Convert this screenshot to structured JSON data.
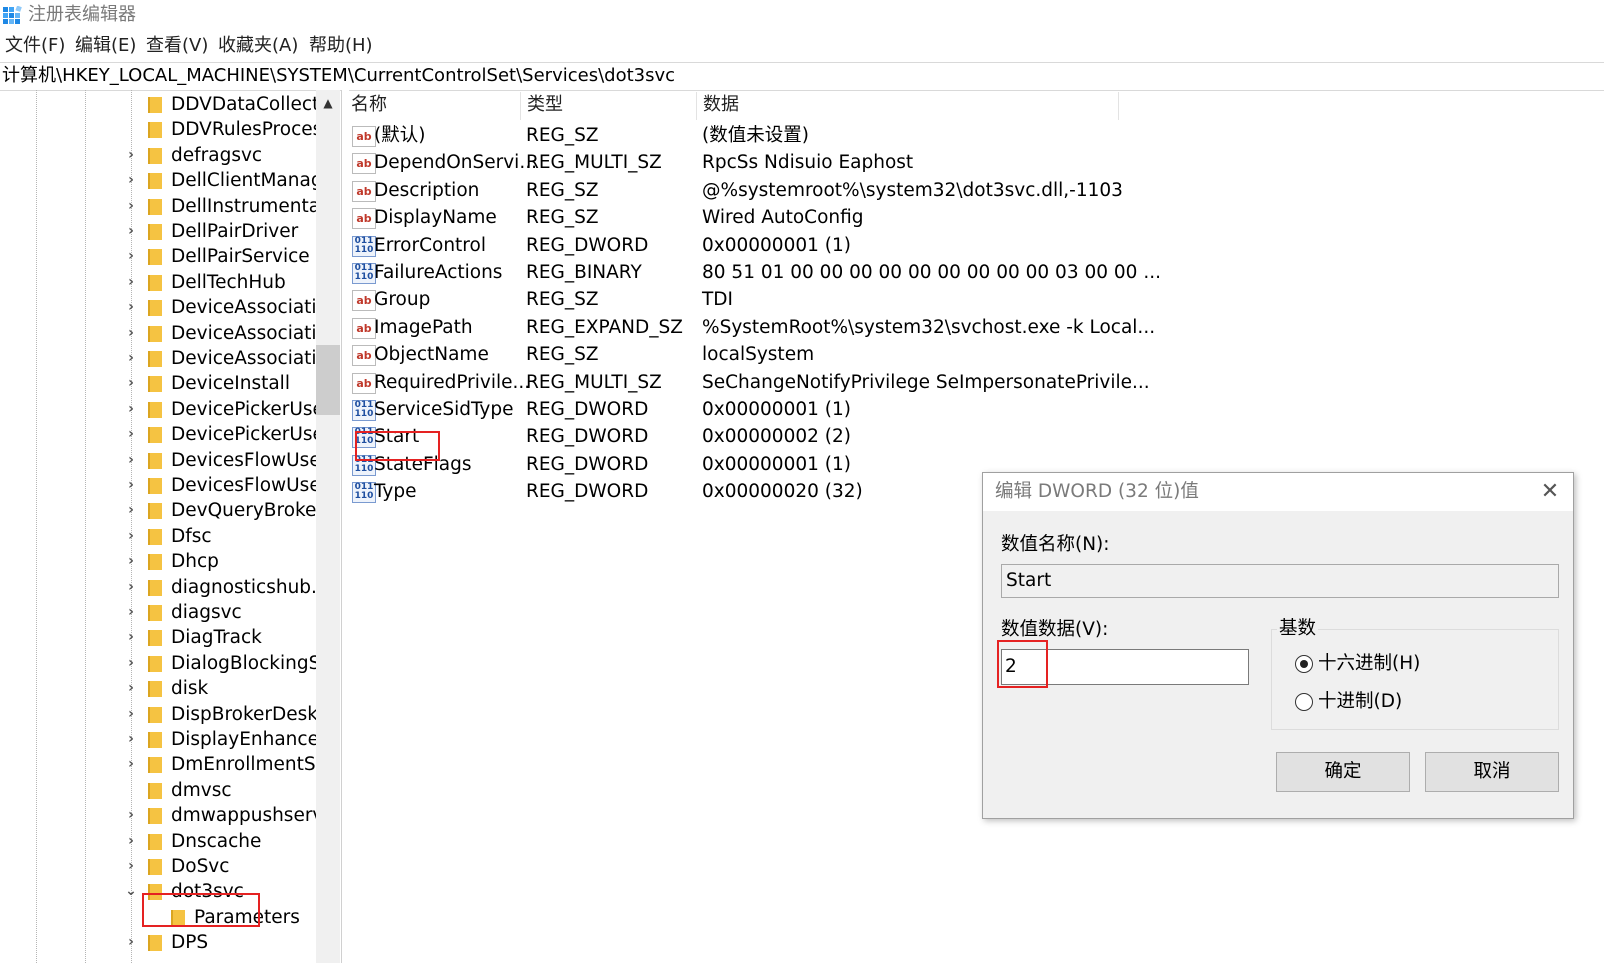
{
  "window": {
    "title": "注册表编辑器"
  },
  "menu": [
    "文件(F)",
    "编辑(E)",
    "查看(V)",
    "收藏夹(A)",
    "帮助(H)"
  ],
  "address": "计算机\\HKEY_LOCAL_MACHINE\\SYSTEM\\CurrentControlSet\\Services\\dot3svc",
  "tree": [
    {
      "label": "DDVDataCollect",
      "arrow": ""
    },
    {
      "label": "DDVRulesProces",
      "arrow": ""
    },
    {
      "label": "defragsvc",
      "arrow": ">"
    },
    {
      "label": "DellClientManag",
      "arrow": ">"
    },
    {
      "label": "DellInstrumentat",
      "arrow": ">"
    },
    {
      "label": "DellPairDriver",
      "arrow": ">"
    },
    {
      "label": "DellPairService",
      "arrow": ">"
    },
    {
      "label": "DellTechHub",
      "arrow": ">"
    },
    {
      "label": "DeviceAssociatic",
      "arrow": ">"
    },
    {
      "label": "DeviceAssociatic",
      "arrow": ">"
    },
    {
      "label": "DeviceAssociatic",
      "arrow": ">"
    },
    {
      "label": "DeviceInstall",
      "arrow": ">"
    },
    {
      "label": "DevicePickerUse",
      "arrow": ">"
    },
    {
      "label": "DevicePickerUse",
      "arrow": ">"
    },
    {
      "label": "DevicesFlowUser",
      "arrow": ">"
    },
    {
      "label": "DevicesFlowUser",
      "arrow": ">"
    },
    {
      "label": "DevQueryBroker",
      "arrow": ">"
    },
    {
      "label": "Dfsc",
      "arrow": ">"
    },
    {
      "label": "Dhcp",
      "arrow": ">"
    },
    {
      "label": "diagnosticshub.s",
      "arrow": ">"
    },
    {
      "label": "diagsvc",
      "arrow": ">"
    },
    {
      "label": "DiagTrack",
      "arrow": ">"
    },
    {
      "label": "DialogBlockingS",
      "arrow": ">"
    },
    {
      "label": "disk",
      "arrow": ">"
    },
    {
      "label": "DispBrokerDeskt",
      "arrow": ">"
    },
    {
      "label": "DisplayEnhancer",
      "arrow": ">"
    },
    {
      "label": "DmEnrollmentSv",
      "arrow": ">"
    },
    {
      "label": "dmvsc",
      "arrow": ""
    },
    {
      "label": "dmwappushserv",
      "arrow": ">"
    },
    {
      "label": "Dnscache",
      "arrow": ">"
    },
    {
      "label": "DoSvc",
      "arrow": ">"
    },
    {
      "label": "dot3svc",
      "arrow": "v"
    },
    {
      "label": "Parameters",
      "arrow": "",
      "child": true
    },
    {
      "label": "DPS",
      "arrow": ">"
    }
  ],
  "columns": {
    "name": "名称",
    "type": "类型",
    "data": "数据"
  },
  "values": [
    {
      "icon": "ab",
      "name": "(默认)",
      "type": "REG_SZ",
      "data": "(数值未设置)"
    },
    {
      "icon": "ab",
      "name": "DependOnServi...",
      "type": "REG_MULTI_SZ",
      "data": "RpcSs Ndisuio Eaphost"
    },
    {
      "icon": "ab",
      "name": "Description",
      "type": "REG_SZ",
      "data": "@%systemroot%\\system32\\dot3svc.dll,-1103"
    },
    {
      "icon": "ab",
      "name": "DisplayName",
      "type": "REG_SZ",
      "data": "Wired AutoConfig"
    },
    {
      "icon": "bin",
      "name": "ErrorControl",
      "type": "REG_DWORD",
      "data": "0x00000001 (1)"
    },
    {
      "icon": "bin",
      "name": "FailureActions",
      "type": "REG_BINARY",
      "data": "80 51 01 00 00 00 00 00 00 00 00 00 03 00 00 ..."
    },
    {
      "icon": "ab",
      "name": "Group",
      "type": "REG_SZ",
      "data": "TDI"
    },
    {
      "icon": "ab",
      "name": "ImagePath",
      "type": "REG_EXPAND_SZ",
      "data": "%SystemRoot%\\system32\\svchost.exe -k Local..."
    },
    {
      "icon": "ab",
      "name": "ObjectName",
      "type": "REG_SZ",
      "data": "localSystem"
    },
    {
      "icon": "ab",
      "name": "RequiredPrivile...",
      "type": "REG_MULTI_SZ",
      "data": "SeChangeNotifyPrivilege SeImpersonatePrivile..."
    },
    {
      "icon": "bin",
      "name": "ServiceSidType",
      "type": "REG_DWORD",
      "data": "0x00000001 (1)"
    },
    {
      "icon": "bin",
      "name": "Start",
      "type": "REG_DWORD",
      "data": "0x00000002 (2)"
    },
    {
      "icon": "bin",
      "name": "StateFlags",
      "type": "REG_DWORD",
      "data": "0x00000001 (1)"
    },
    {
      "icon": "bin",
      "name": "Type",
      "type": "REG_DWORD",
      "data": "0x00000020 (32)"
    }
  ],
  "icons": {
    "ab": "ab",
    "bin": "011\n110"
  },
  "dialog": {
    "title": "编辑 DWORD (32 位)值",
    "close": "✕",
    "name_label": "数值名称(N):",
    "name_value": "Start",
    "data_label": "数值数据(V):",
    "data_value": "2",
    "base_label": "基数",
    "hex_label": "十六进制(H)",
    "dec_label": "十进制(D)",
    "ok": "确定",
    "cancel": "取消"
  },
  "colors": {
    "highlight": "#e52222",
    "folder": "#f5c342"
  }
}
